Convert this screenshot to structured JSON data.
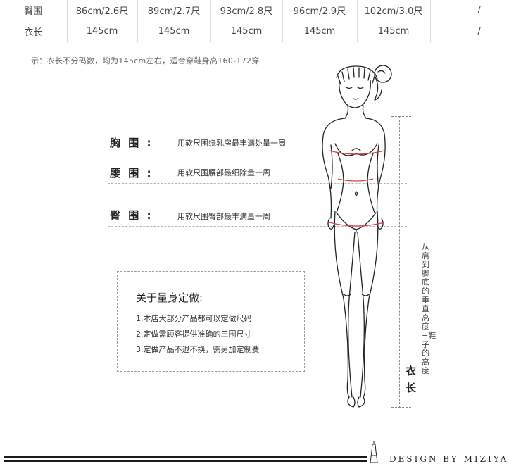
{
  "size_table": {
    "rows": [
      {
        "label": "臀围",
        "values": [
          "86cm/2.6尺",
          "89cm/2.7尺",
          "93cm/2.8尺",
          "96cm/2.9尺",
          "102cm/3.0尺",
          "/"
        ]
      },
      {
        "label": "衣长",
        "values": [
          "145cm",
          "145cm",
          "145cm",
          "145cm",
          "145cm",
          "/"
        ]
      }
    ]
  },
  "note": "示：衣长不分码数，均为145cm左右，适合穿鞋身高160-172穿",
  "measurements": [
    {
      "label": "胸 围 :",
      "desc": "用软尺围绕乳房最丰满处量一周"
    },
    {
      "label": "腰 围 :",
      "desc": "用软尺围腰部最细除量一周"
    },
    {
      "label": "臀 围 :",
      "desc": "用软尺围臀部最丰满量一周"
    }
  ],
  "custom_box": {
    "title": "关于量身定做:",
    "items": [
      "1.本店大部分产品都可以定做尺码",
      "2.定做需顾客提供准确的三围尺寸",
      "3.定做产品不退不换，需另加定制费"
    ]
  },
  "length_note": "从肩到脚底的垂直高度+鞋子的高度",
  "length_label": "衣长",
  "footer": "DESIGN BY MIZIYA"
}
